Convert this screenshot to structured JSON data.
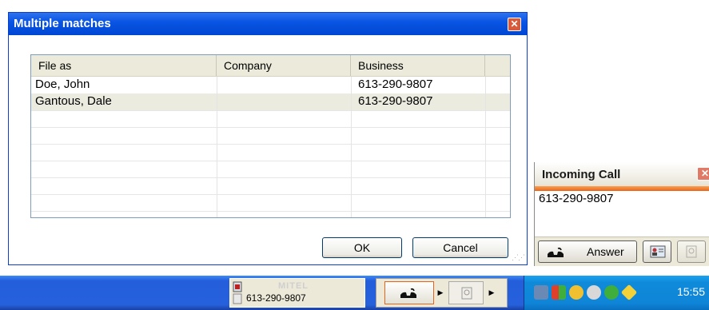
{
  "dialog": {
    "title": "Multiple matches",
    "columns": [
      "File as",
      "Company",
      "Business"
    ],
    "rows": [
      {
        "file_as": "Doe, John",
        "company": "",
        "business": "613-290-9807"
      },
      {
        "file_as": "Gantous, Dale",
        "company": "",
        "business": "613-290-9807"
      }
    ],
    "ok_label": "OK",
    "cancel_label": "Cancel"
  },
  "incoming_call": {
    "title": "Incoming Call",
    "number": "613-290-9807",
    "answer_label": "Answer"
  },
  "taskbar": {
    "phone_number": "613-290-9807",
    "brand_watermark": "MITEL",
    "clock": "15:55"
  },
  "colors": {
    "title_bar": "#0a55e3",
    "close_button": "#d95a3a",
    "incoming_stripe": "#e8641c",
    "taskbar": "#245edb",
    "systray": "#0f85d8"
  }
}
